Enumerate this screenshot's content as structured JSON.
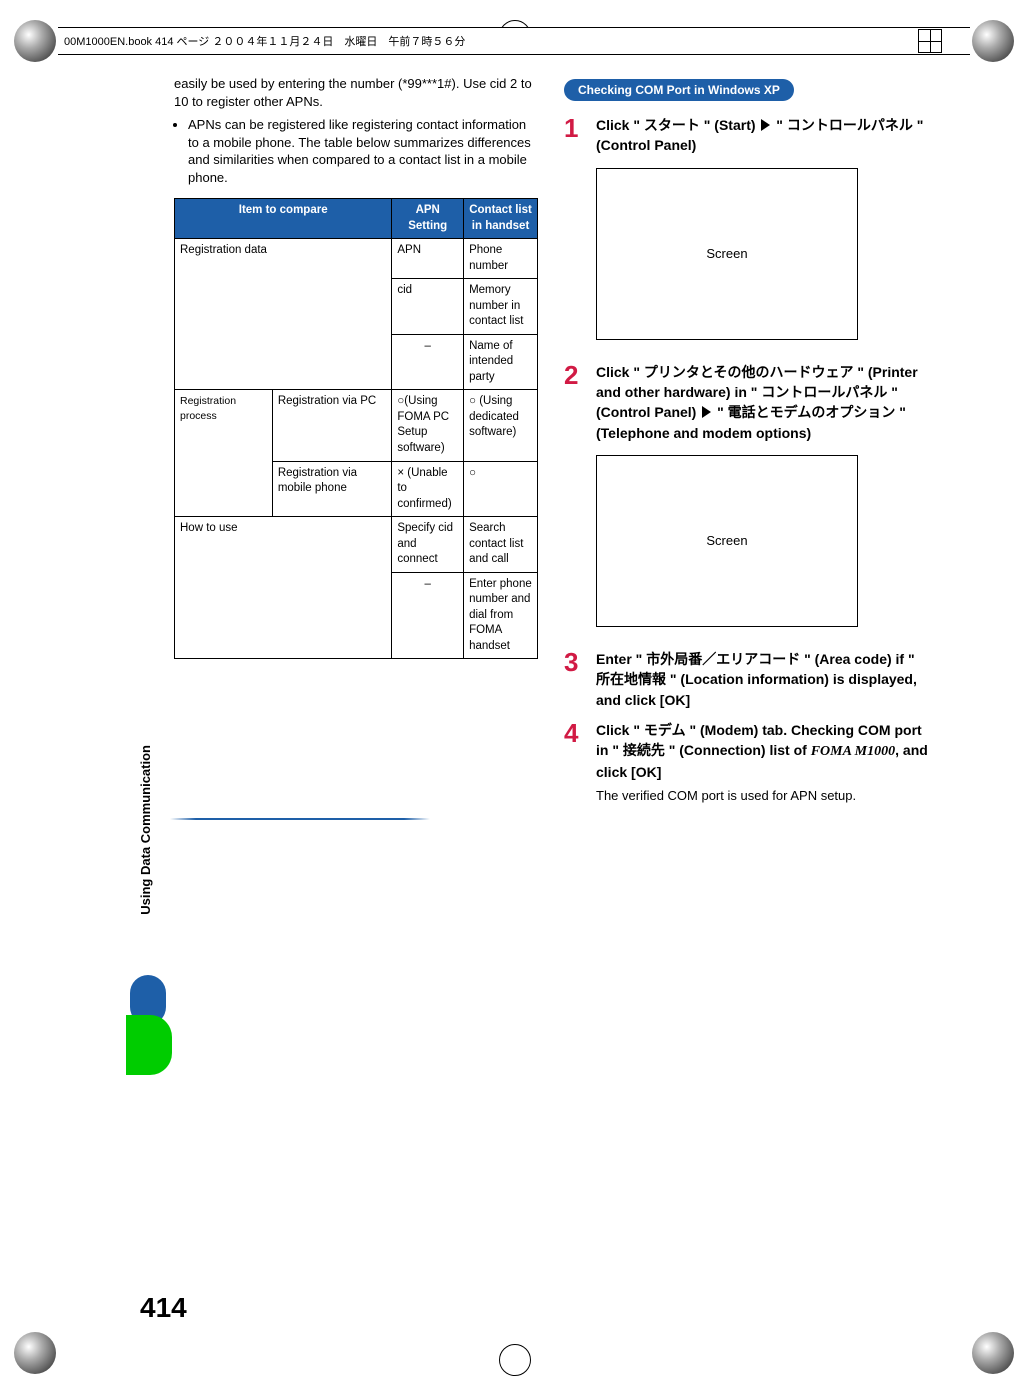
{
  "header": {
    "text": "00M1000EN.book  414 ページ  ２００４年１１月２４日　水曜日　午前７時５６分"
  },
  "intro": {
    "paragraph": "easily be used by entering the number (*99***1#). Use cid 2 to 10 to register other APNs.",
    "bullet": "APNs can be registered like registering contact information to a mobile phone. The table below summarizes differences and similarities when compared to a contact list in a mobile phone."
  },
  "table": {
    "headers": {
      "item": "Item to compare",
      "apn": "APN Setting",
      "contact": "Contact list in handset"
    },
    "rows": {
      "r1": {
        "item": "Registration data",
        "apn": "APN",
        "contact": "Phone number"
      },
      "r2": {
        "apn": "cid",
        "contact": "Memory number in contact list"
      },
      "r3": {
        "apn": "–",
        "contact": "Name of intended party"
      },
      "r4label": "Registration process",
      "r4a": {
        "sub": "Registration via PC",
        "apn": "○(Using FOMA PC Setup software)",
        "contact": "○ (Using dedicated software)"
      },
      "r4b": {
        "sub": "Registration via mobile phone",
        "apn": "× (Unable to confirmed)",
        "contact": "○"
      },
      "r5": {
        "item": "How to use",
        "apn": "Specify cid and connect",
        "contact": "Search contact list and call"
      },
      "r6": {
        "apn": "–",
        "contact": "Enter phone number and dial from FOMA handset"
      }
    }
  },
  "right": {
    "section_title": "Checking COM Port in Windows XP",
    "screen_label": "Screen",
    "steps": {
      "s1": {
        "num": "1",
        "text_pre": "Click \" スタート \" (Start) ",
        "text_post": " \" コントロールパネル \" (Control Panel)"
      },
      "s2": {
        "num": "2",
        "text_pre": "Click \" プリンタとその他のハードウェア \" (Printer and other hardware) in \" コントロールパネル \" (Control Panel) ",
        "text_post": " \" 電話とモデムのオプション \" (Telephone and modem options)"
      },
      "s3": {
        "num": "3",
        "text": "Enter \" 市外局番／エリアコード \" (Area code) if \" 所在地情報 \" (Location information) is displayed, and click [OK]"
      },
      "s4": {
        "num": "4",
        "text_pre": "Click \" モデム \" (Modem) tab. Checking COM port in \" 接続先 \" (Connection) list of ",
        "foma": "FOMA M1000",
        "text_post": ", and click [OK]",
        "note": "The verified COM port is used for APN setup."
      }
    }
  },
  "side_label": "Using Data Communication",
  "page_number": "414"
}
